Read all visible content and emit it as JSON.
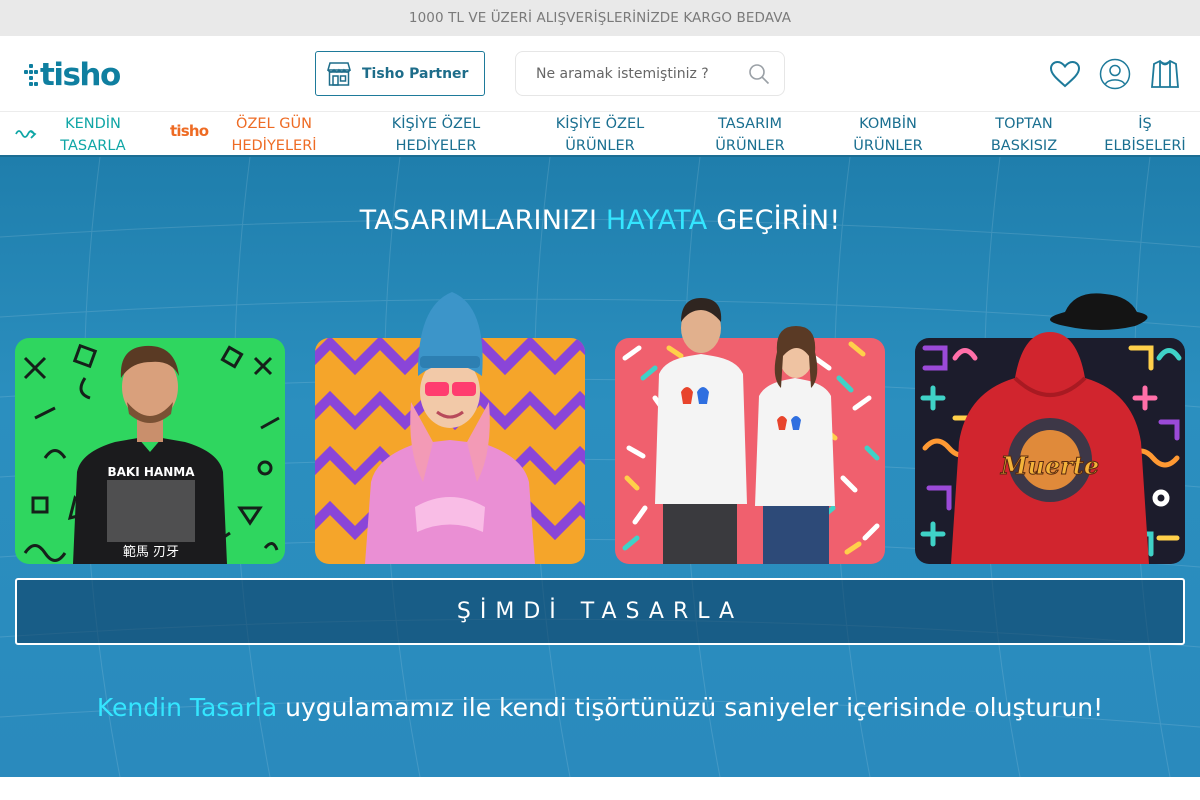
{
  "topbar": {
    "text": "1000 TL VE ÜZERİ ALIŞVERİŞLERİNİZDE KARGO BEDAVA"
  },
  "header": {
    "logo_text": "tisho",
    "partner_label": "Tisho Partner",
    "search_placeholder": "Ne aramak istemiştiniz ?",
    "icons": [
      "heart-icon",
      "user-icon",
      "shirt-icon"
    ]
  },
  "nav": {
    "items": [
      {
        "label": "KENDİN\nTASARLA",
        "color": "#10a6a6"
      },
      {
        "label": "ÖZEL GÜN\nHEDİYELERİ",
        "color": "#ee6b24",
        "logo": "tisho"
      },
      {
        "label": "KİŞİYE ÖZEL\nHEDİYELER",
        "color": "#1a6f90"
      },
      {
        "label": "KİŞİYE ÖZEL\nÜRÜNLER",
        "color": "#1a6f90"
      },
      {
        "label": "TASARIM\nÜRÜNLER",
        "color": "#1a6f90"
      },
      {
        "label": "KOMBİN\nÜRÜNLER",
        "color": "#1a6f90"
      },
      {
        "label": "TOPTAN\nBASKISIZ",
        "color": "#1a6f90"
      },
      {
        "label": "İŞ\nELBİSELERİ",
        "color": "#1a6f90"
      }
    ]
  },
  "hero": {
    "title_part1": "TASARIMLARINIZI ",
    "title_accent": "HAYATA",
    "title_part2": " GEÇİRİN!",
    "cards": [
      {
        "name": "black-tshirt-man",
        "bg_color": "#2fd65f",
        "shirt_text_top": "BAKI HANMA",
        "shirt_text_bottom": "範馬 刃牙"
      },
      {
        "name": "pink-sweatshirt-woman",
        "bg_color": "#f5a52a"
      },
      {
        "name": "white-tshirt-couple",
        "bg_color": "#f0606e"
      },
      {
        "name": "red-hoodie",
        "bg_color": "#1c1c2c",
        "hoodie_text": "Muerte"
      }
    ],
    "cta_label": "ŞİMDİ TASARLA",
    "tagline_accent": "Kendin Tasarla",
    "tagline_rest": " uygulamamız ile kendi tişörtünüzü saniyeler içerisinde oluşturun!"
  },
  "colors": {
    "brand": "#0f7fa0",
    "accent": "#34e6ff",
    "orange": "#ee6b24",
    "hero_bg": "#2a8abd"
  }
}
